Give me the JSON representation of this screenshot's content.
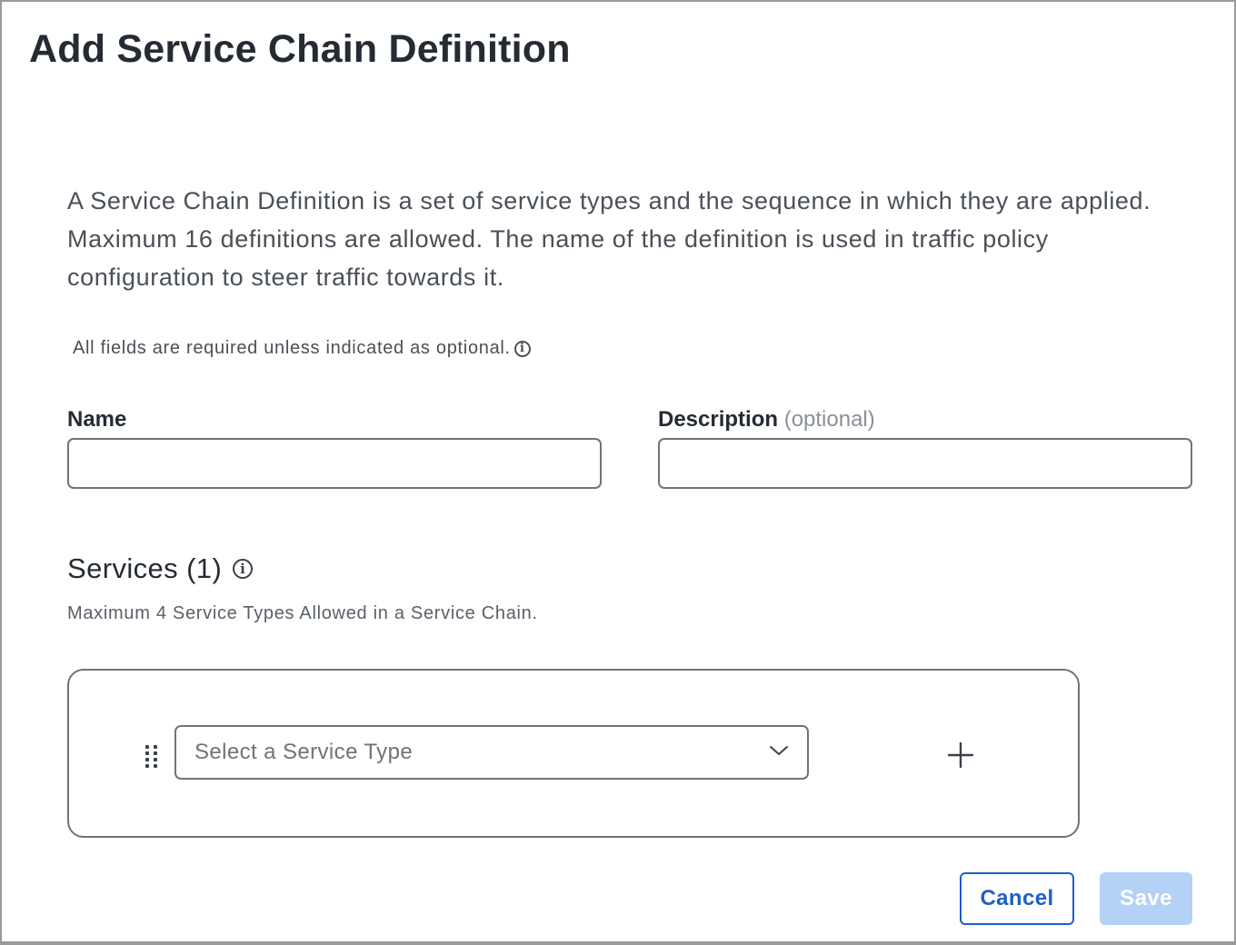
{
  "dialog": {
    "title": "Add Service Chain Definition",
    "intro": "A Service Chain Definition is a set of service types and the sequence in which they are applied. Maximum 16 definitions are allowed. The name of the definition is used in traffic policy configuration to steer traffic towards it.",
    "required_note": "All fields are required unless indicated as optional.",
    "info_icon": "info-icon"
  },
  "form": {
    "name_label": "Name",
    "name_value": "",
    "description_label": "Description",
    "description_optional": "(optional)",
    "description_value": ""
  },
  "services": {
    "heading": "Services (1)",
    "note": "Maximum 4 Service Types Allowed in a Service Chain.",
    "items": [
      {
        "placeholder": "Select a Service Type",
        "handle_icon": "drag-handle-icon",
        "chevron_icon": "chevron-down-icon",
        "add_icon": "plus-icon"
      }
    ]
  },
  "actions": {
    "cancel_label": "Cancel",
    "save_label": "Save",
    "save_enabled": false
  },
  "colors": {
    "primary": "#1e5fc6",
    "primary_disabled": "#b4d1f6",
    "text_dark": "#252b33",
    "text_muted": "#4a5058",
    "border": "#6e747c"
  }
}
